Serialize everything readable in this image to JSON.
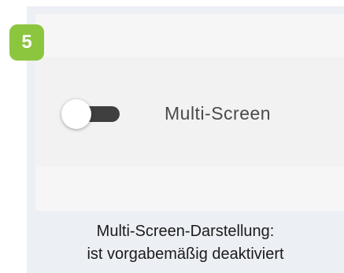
{
  "step_badge": "5",
  "setting": {
    "label": "Multi-Screen",
    "enabled": false
  },
  "caption": {
    "line1": "Multi-Screen-Darstellung:",
    "line2": "ist vorgabemäßig deaktiviert"
  },
  "colors": {
    "badge": "#8cc63f",
    "toggle_track": "#3f3f3f",
    "frame_bg": "#eceff4"
  }
}
